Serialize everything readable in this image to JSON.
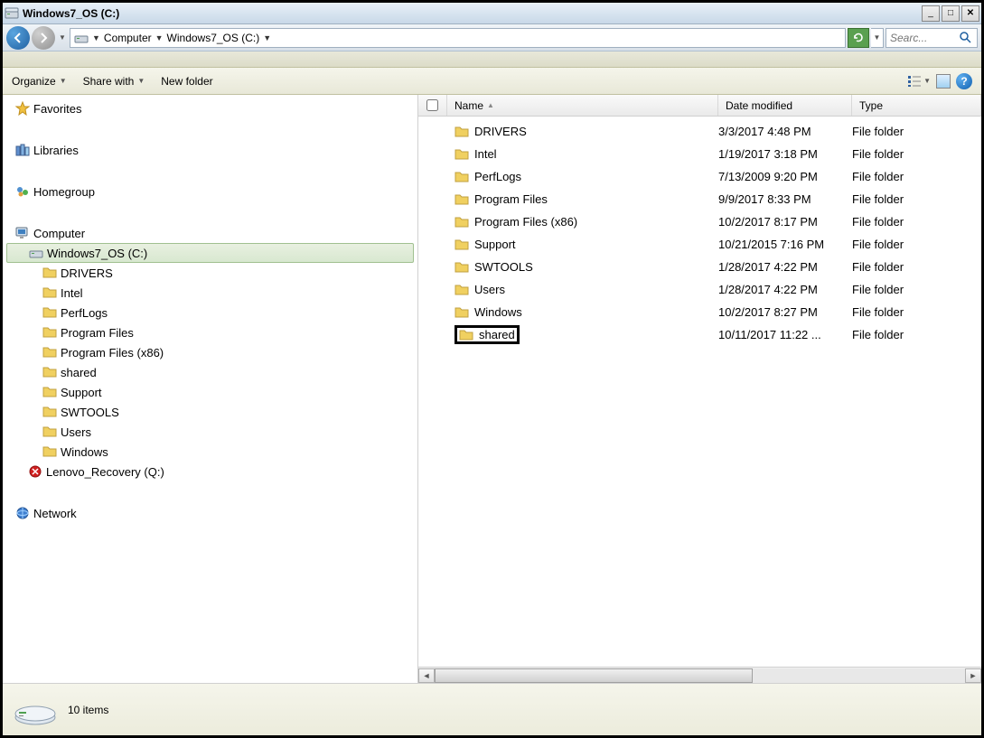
{
  "window": {
    "title": "Windows7_OS (C:)"
  },
  "breadcrumb": {
    "seg1": "Computer",
    "seg2": "Windows7_OS (C:)"
  },
  "search": {
    "placeholder": "Searc..."
  },
  "toolbar": {
    "organize": "Organize",
    "share": "Share with",
    "newfolder": "New folder"
  },
  "columns": {
    "name": "Name",
    "date": "Date modified",
    "type": "Type"
  },
  "sidebar": {
    "favorites": "Favorites",
    "libraries": "Libraries",
    "homegroup": "Homegroup",
    "computer": "Computer",
    "network": "Network",
    "selected": "Windows7_OS (C:)",
    "lenovo": "Lenovo_Recovery (Q:)",
    "children": [
      "DRIVERS",
      "Intel",
      "PerfLogs",
      "Program Files",
      "Program Files (x86)",
      "shared",
      "Support",
      "SWTOOLS",
      "Users",
      "Windows"
    ]
  },
  "files": [
    {
      "name": "DRIVERS",
      "date": "3/3/2017 4:48 PM",
      "type": "File folder"
    },
    {
      "name": "Intel",
      "date": "1/19/2017 3:18 PM",
      "type": "File folder"
    },
    {
      "name": "PerfLogs",
      "date": "7/13/2009 9:20 PM",
      "type": "File folder"
    },
    {
      "name": "Program Files",
      "date": "9/9/2017 8:33 PM",
      "type": "File folder"
    },
    {
      "name": "Program Files (x86)",
      "date": "10/2/2017 8:17 PM",
      "type": "File folder"
    },
    {
      "name": "Support",
      "date": "10/21/2015 7:16 PM",
      "type": "File folder"
    },
    {
      "name": "SWTOOLS",
      "date": "1/28/2017 4:22 PM",
      "type": "File folder"
    },
    {
      "name": "Users",
      "date": "1/28/2017 4:22 PM",
      "type": "File folder"
    },
    {
      "name": "Windows",
      "date": "10/2/2017 8:27 PM",
      "type": "File folder"
    },
    {
      "name": "shared",
      "date": "10/11/2017 11:22 ...",
      "type": "File folder"
    }
  ],
  "status": {
    "count": "10 items"
  }
}
